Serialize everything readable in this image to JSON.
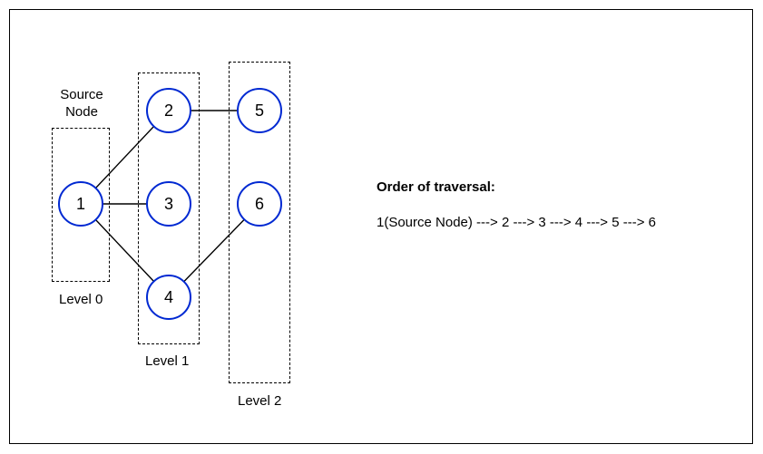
{
  "labels": {
    "source": "Source\nNode",
    "level0": "Level 0",
    "level1": "Level 1",
    "level2": "Level 2",
    "traversal_title": "Order of traversal:",
    "traversal_text": "1(Source Node) ---> 2 ---> 3 ---> 4 ---> 5 ---> 6"
  },
  "nodes": {
    "n1": "1",
    "n2": "2",
    "n3": "3",
    "n4": "4",
    "n5": "5",
    "n6": "6"
  },
  "chart_data": {
    "type": "graph",
    "description": "Breadth-first search (BFS) level structure from source node 1",
    "nodes": [
      {
        "id": 1,
        "level": 0,
        "source": true
      },
      {
        "id": 2,
        "level": 1
      },
      {
        "id": 3,
        "level": 1
      },
      {
        "id": 4,
        "level": 1
      },
      {
        "id": 5,
        "level": 2
      },
      {
        "id": 6,
        "level": 2
      }
    ],
    "edges": [
      [
        1,
        2
      ],
      [
        1,
        3
      ],
      [
        1,
        4
      ],
      [
        2,
        5
      ],
      [
        4,
        6
      ]
    ],
    "levels": {
      "Level 0": [
        1
      ],
      "Level 1": [
        2,
        3,
        4
      ],
      "Level 2": [
        5,
        6
      ]
    },
    "traversal_order": [
      1,
      2,
      3,
      4,
      5,
      6
    ]
  }
}
